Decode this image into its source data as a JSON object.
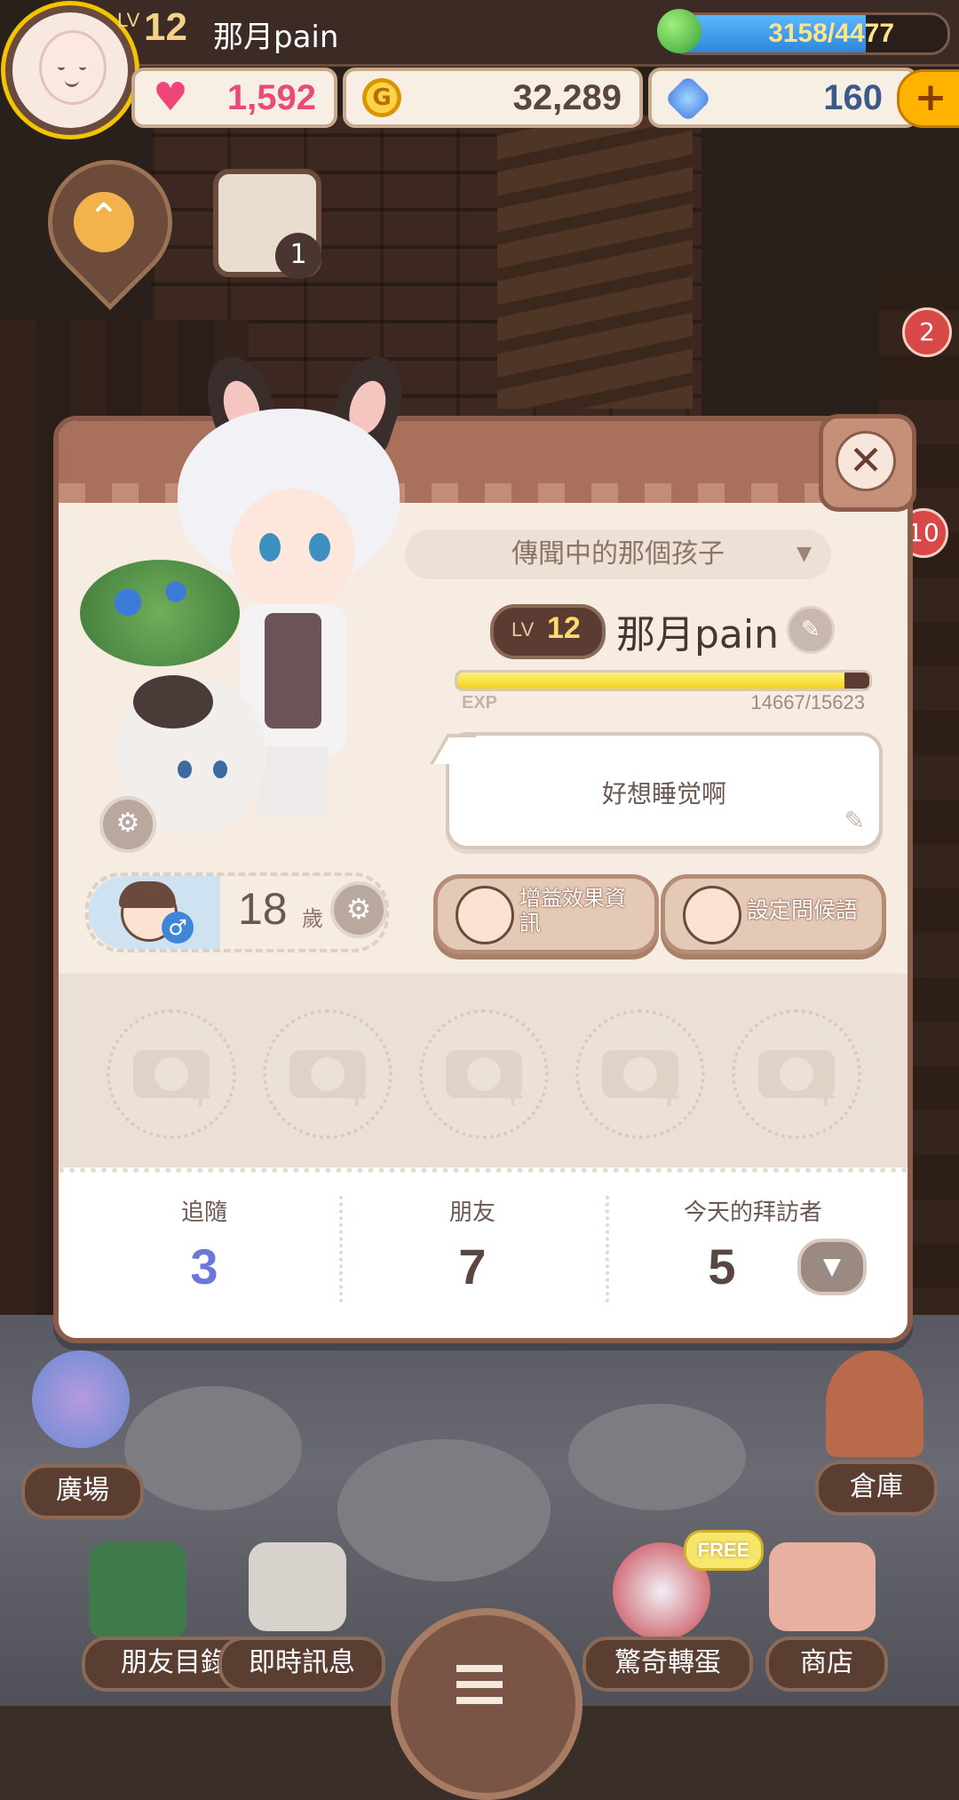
{
  "topbar": {
    "level_tag": "LV",
    "level": "12",
    "player_name": "那月pain",
    "energy": {
      "text": "3158/4477",
      "current": 3158,
      "max": 4477
    },
    "hearts": "1,592",
    "coins": "32,289",
    "gems": "160",
    "plus_label": "+"
  },
  "scene": {
    "calendar_badge": "1",
    "mailbox_badge": "2",
    "side_badge": "10"
  },
  "profile": {
    "close_label": "✕",
    "title_label": "傳聞中的那個孩子",
    "level_tag": "LV",
    "level": "12",
    "name": "那月pain",
    "exp_label": "EXP",
    "exp_value": "14667/15623",
    "exp_current": 14667,
    "exp_max": 15623,
    "status_message": "好想睡觉啊",
    "age": "18",
    "age_unit": "歲",
    "buff_button_label": "增益效果資訊",
    "greeting_button_label": "設定問候語",
    "stats": {
      "following_label": "追隨",
      "following_value": "3",
      "friends_label": "朋友",
      "friends_value": "7",
      "visitors_label": "今天的拜訪者",
      "visitors_value": "5"
    }
  },
  "bottom_nav": {
    "plaza": "廣場",
    "warehouse": "倉庫",
    "friend_list": "朋友目錄",
    "instant_message": "即時訊息",
    "gacha": "驚奇轉蛋",
    "gacha_badge": "FREE",
    "shop": "商店"
  },
  "colors": {
    "modal_border": "#8c5c4a",
    "accent_gold": "#f2c500",
    "following_blue": "#6a78d8"
  }
}
